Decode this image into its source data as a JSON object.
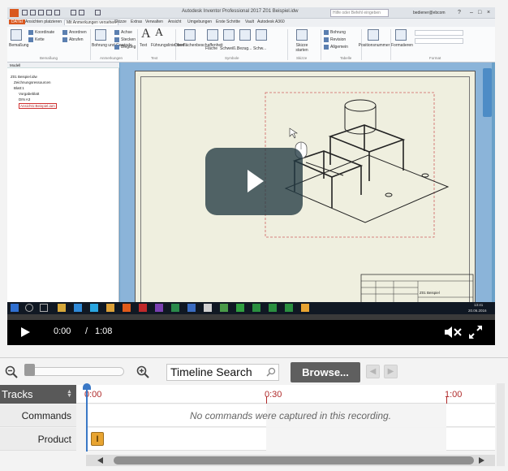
{
  "app": {
    "window_title": "Autodesk Inventor Professional 2017   Z01 Beispiel.idw",
    "search_placeholder": "Hilfe oder Befehl eingeben",
    "user": "bediener@ebcom"
  },
  "ribbon": {
    "tabs": [
      "DATEI",
      "Ansichten platzieren",
      "Mit Anmerkungen versehen",
      "Skizze",
      "Extras",
      "Verwalten",
      "Ansicht",
      "Umgebungen",
      "Erste Schritte",
      "Vault",
      "Autodesk A360"
    ],
    "items": [
      {
        "label": "Bemaßung"
      },
      {
        "label": "Koordinate"
      },
      {
        "label": "Kette"
      },
      {
        "label": "Anordnen"
      },
      {
        "label": "Abrufen"
      },
      {
        "label": "Bohrung und Gewinde"
      },
      {
        "label": "Achse"
      },
      {
        "label": "Stecken"
      },
      {
        "label": "Biegung"
      },
      {
        "label": "Text"
      },
      {
        "label": "Führungslinientext"
      },
      {
        "label": "Oberflächenbeschaffenheit"
      },
      {
        "label": "Fläche"
      },
      {
        "label": "Schweiß..."
      },
      {
        "label": "Bezug..."
      },
      {
        "label": "Schw..."
      },
      {
        "label": "Skizze starten"
      },
      {
        "label": "Bohrung"
      },
      {
        "label": "Revision"
      },
      {
        "label": "Allgemein"
      },
      {
        "label": "Positionsnummer"
      },
      {
        "label": "Formatieren"
      }
    ],
    "groups": [
      "Bemaßung",
      "Anmerkungen",
      "Text",
      "Symbole",
      "Skizze",
      "Tabelle",
      "Format"
    ]
  },
  "model_browser": {
    "header": "Modell",
    "items": [
      "Z01 Beispiel.idw",
      "Zeichnungsressourcen",
      "Blatt:1",
      "Vorgabeblatt",
      "DIN A3",
      "Ansicht1:Beispiel.iam"
    ]
  },
  "drawing": {
    "title_block_label": "Z01 Beispiel"
  },
  "taskbar": {
    "time": "13:41",
    "date": "20.06.2016"
  },
  "player": {
    "current_time": "0:00",
    "separator": "/",
    "duration": "1:08",
    "progress_fraction": 0.0
  },
  "toolbar": {
    "search_value": "Timeline Search",
    "browse_label": "Browse..."
  },
  "timeline": {
    "tracks_header": "Tracks",
    "ticks": [
      "0:00",
      "0:30",
      "1:00"
    ],
    "tracks": [
      {
        "name": "Commands",
        "message": "No commands were captured in this recording."
      },
      {
        "name": "Product",
        "icon_letter": "I"
      }
    ]
  },
  "colors": {
    "inventor_orange": "#e8a431",
    "timeline_tick": "#b02a2a",
    "playhead": "#3a78c6"
  },
  "icons": [
    "zoom-out-icon",
    "zoom-in-icon",
    "search-icon",
    "play-icon",
    "mute-icon",
    "fullscreen-icon"
  ]
}
